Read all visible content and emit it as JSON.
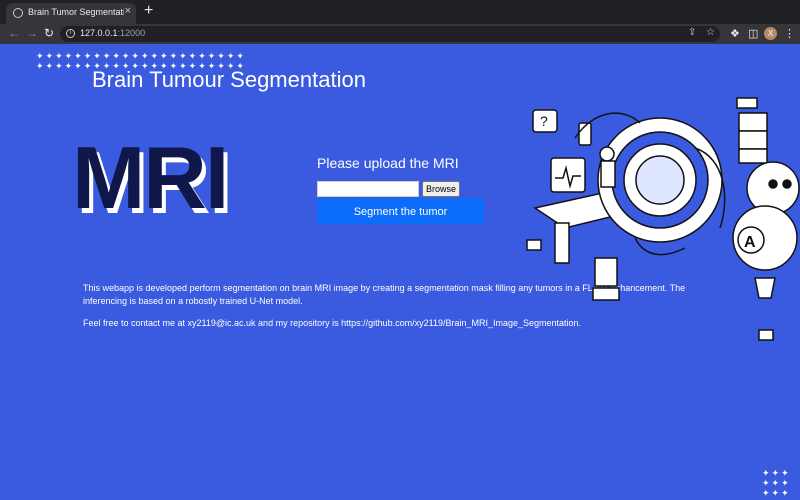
{
  "browser": {
    "tab_title": "Brain Tumor Segmentation U-N",
    "tab_close": "×",
    "new_tab": "+",
    "url_host": "127.0.0.1",
    "url_port": ":12000",
    "profile_initial": "X"
  },
  "page": {
    "title": "Brain Tumour Segmentation",
    "logo_text": "MRI",
    "upload": {
      "label": "Please upload the MRI",
      "file_value": "",
      "browse_label": "Browse",
      "submit_label": "Segment the tumor"
    },
    "description": "This webapp is developed perform segmentation on brain MRI image by creating a segmentation mask filling any tumors in a FLAIR enhancement. The inferencing is based on a robostly trained U-Net model.",
    "contact": "Feel free to contact me at xy2119@ic.ac.uk and my repository is https://github.com/xy2119/Brain_MRI_Image_Segmentation.",
    "robot_badge": "A"
  },
  "colors": {
    "page_background": "#3a5be0",
    "button_primary": "#0b6dfa",
    "logo_text": "#10174a",
    "browser_frame": "#202124",
    "browser_toolbar": "#35363a"
  },
  "icons": {
    "back": "arrow-left-icon",
    "forward": "arrow-right-icon",
    "reload": "reload-icon",
    "info": "info-icon",
    "share": "share-icon",
    "bookmark": "star-icon",
    "extensions": "puzzle-icon",
    "sidebar": "sidebar-icon",
    "menu": "kebab-menu-icon"
  }
}
